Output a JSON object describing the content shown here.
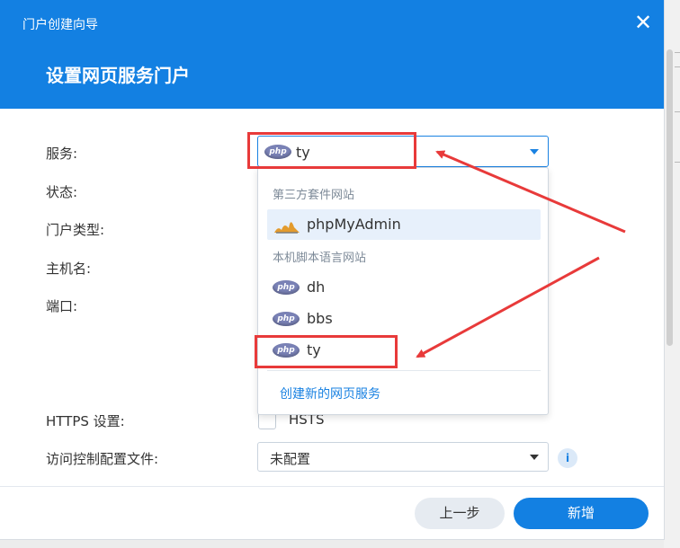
{
  "dialog": {
    "title": "门户创建向导",
    "subtitle": "设置网页服务门户",
    "close_glyph": "✕"
  },
  "form": {
    "labels": {
      "service": "服务:",
      "status": "状态:",
      "portal_type": "门户类型:",
      "hostname": "主机名:",
      "port": "端口:",
      "https": "HTTPS 设置:",
      "access_profile": "访问控制配置文件:"
    },
    "service_value": "ty",
    "hsts_label": "HSTS",
    "access_profile_value": "未配置",
    "info_glyph": "i"
  },
  "dropdown": {
    "groups": [
      {
        "title": "第三方套件网站",
        "items": [
          {
            "label": "phpMyAdmin",
            "icon": "phpmyadmin-icon",
            "selected": true
          }
        ]
      },
      {
        "title": "本机脚本语言网站",
        "items": [
          {
            "label": "dh",
            "icon": "php-icon",
            "selected": false
          },
          {
            "label": "bbs",
            "icon": "php-icon",
            "selected": false
          },
          {
            "label": "ty",
            "icon": "php-icon",
            "selected": false
          }
        ]
      }
    ],
    "create_link": "创建新的网页服务"
  },
  "php_logo_text": "php",
  "footer": {
    "prev_label": "上一步",
    "add_label": "新增"
  },
  "colors": {
    "accent": "#1380e2",
    "annotation": "#e83a3a",
    "selected_row": "#e7f0fb"
  }
}
